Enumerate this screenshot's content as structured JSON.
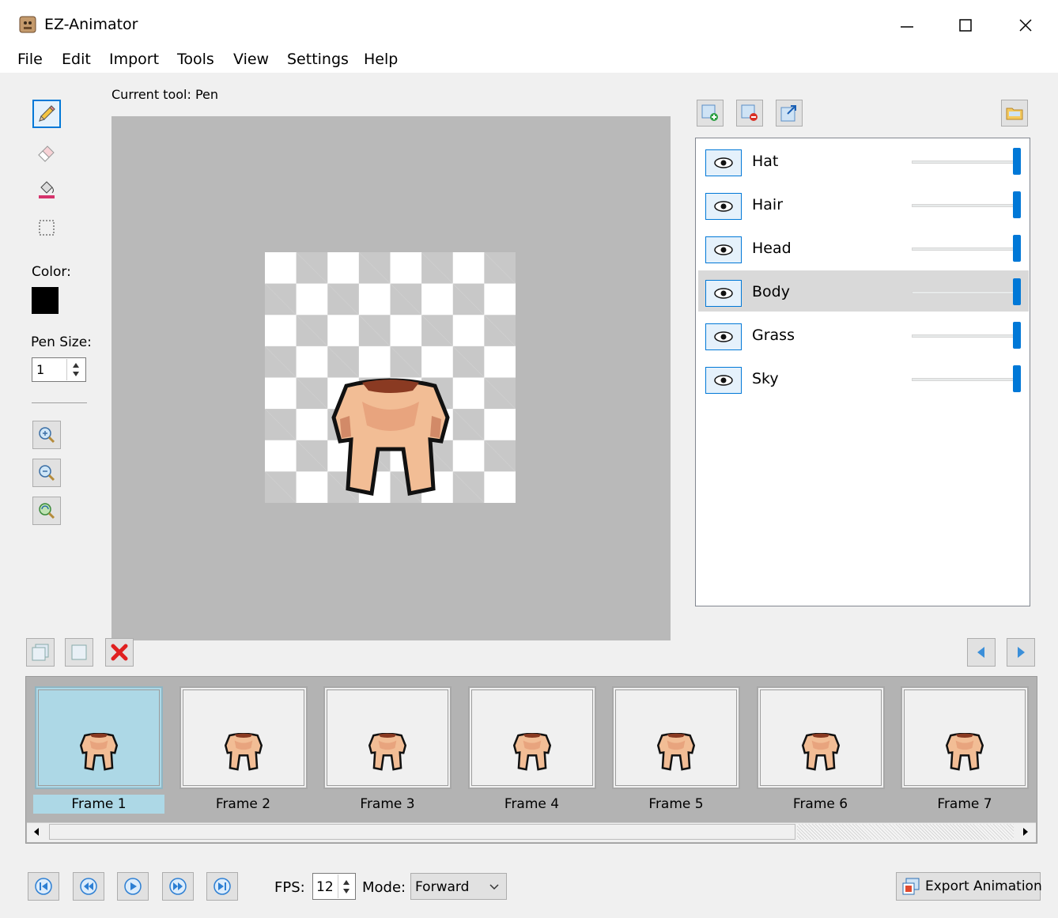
{
  "window": {
    "title": "EZ-Animator",
    "minimize": "—",
    "maximize": "☐",
    "close": "✕"
  },
  "menu": [
    "File",
    "Edit",
    "Import",
    "Tools",
    "View",
    "Settings",
    "Help"
  ],
  "toolbar": {
    "current_tool_label": "Current tool: Pen",
    "color_label": "Color:",
    "color_value": "#000000",
    "pen_size_label": "Pen Size:",
    "pen_size_value": "1"
  },
  "layers": [
    {
      "name": "Hat",
      "opacity_fraction": 1.0,
      "selected": false
    },
    {
      "name": "Hair",
      "opacity_fraction": 1.0,
      "selected": false
    },
    {
      "name": "Head",
      "opacity_fraction": 1.0,
      "selected": false
    },
    {
      "name": "Body",
      "opacity_fraction": 1.0,
      "selected": true
    },
    {
      "name": "Grass",
      "opacity_fraction": 1.0,
      "selected": false
    },
    {
      "name": "Sky",
      "opacity_fraction": 1.0,
      "selected": false
    }
  ],
  "frames": [
    {
      "label": "Frame 1",
      "selected": true
    },
    {
      "label": "Frame 2",
      "selected": false
    },
    {
      "label": "Frame 3",
      "selected": false
    },
    {
      "label": "Frame 4",
      "selected": false
    },
    {
      "label": "Frame 5",
      "selected": false
    },
    {
      "label": "Frame 6",
      "selected": false
    },
    {
      "label": "Frame 7",
      "selected": false
    }
  ],
  "playback": {
    "fps_label": "FPS:",
    "fps_value": "12",
    "mode_label": "Mode:",
    "mode_value": "Forward",
    "export_label": "Export Animation"
  },
  "colors": {
    "accent": "#0078d7",
    "frame_selected": "#add8e6",
    "canvas_bg": "#b9b9b9",
    "delete_red": "#e02020"
  }
}
